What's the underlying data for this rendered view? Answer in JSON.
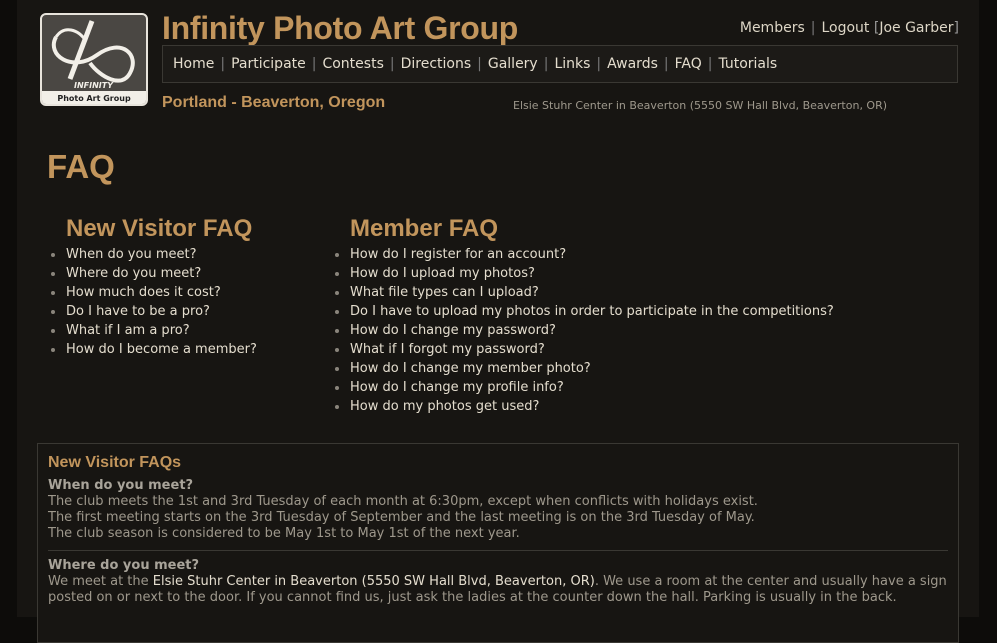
{
  "header": {
    "site_title": "Infinity Photo Art Group",
    "logo": {
      "line1": "INFINITY",
      "line2": "Photo Art Group"
    },
    "user_links": {
      "members": "Members",
      "logout": "Logout",
      "user_name": "Joe Garber",
      "separator": "|",
      "bracket_open": "[",
      "bracket_close": "]"
    },
    "location": "Portland - Beaverton, Oregon",
    "venue": "Elsie Stuhr Center in Beaverton (5550 SW Hall Blvd, Beaverton, OR)"
  },
  "nav": {
    "separator": "|",
    "items": [
      "Home",
      "Participate",
      "Contests",
      "Directions",
      "Gallery",
      "Links",
      "Awards",
      "FAQ",
      "Tutorials"
    ]
  },
  "page_heading": "FAQ",
  "new_visitor_faq": {
    "heading": "New Visitor FAQ",
    "items": [
      "When do you meet?",
      "Where do you meet?",
      "How much does it cost?",
      "Do I have to be a pro?",
      "What if I am a pro?",
      "How do I become a member?"
    ]
  },
  "member_faq": {
    "heading": "Member FAQ",
    "items": [
      "How do I register for an account?",
      "How do I upload my photos?",
      "What file types can I upload?",
      "Do I have to upload my photos in order to participate in the competitions?",
      "How do I change my password?",
      "What if I forgot my password?",
      "How do I change my member photo?",
      "How do I change my profile info?",
      "How do my photos get used?"
    ]
  },
  "answers": {
    "heading": "New Visitor FAQs",
    "q1": {
      "question": "When do you meet?",
      "lines": [
        "The club meets the 1st and 3rd Tuesday of each month at 6:30pm, except when conflicts with holidays exist.",
        "The first meeting starts on the 3rd Tuesday of September and the last meeting is on the 3rd Tuesday of May.",
        "The club season is considered to be May 1st to May 1st of the next year."
      ]
    },
    "q2": {
      "question": "Where do you meet?",
      "text_before": "We meet at the ",
      "link": "Elsie Stuhr Center in Beaverton (5550 SW Hall Blvd, Beaverton, OR)",
      "text_after": ". We use a room at the center and usually have a sign posted on or next to the door. If you cannot find us, just ask the ladies at the counter down the hall. Parking is usually in the back."
    }
  }
}
